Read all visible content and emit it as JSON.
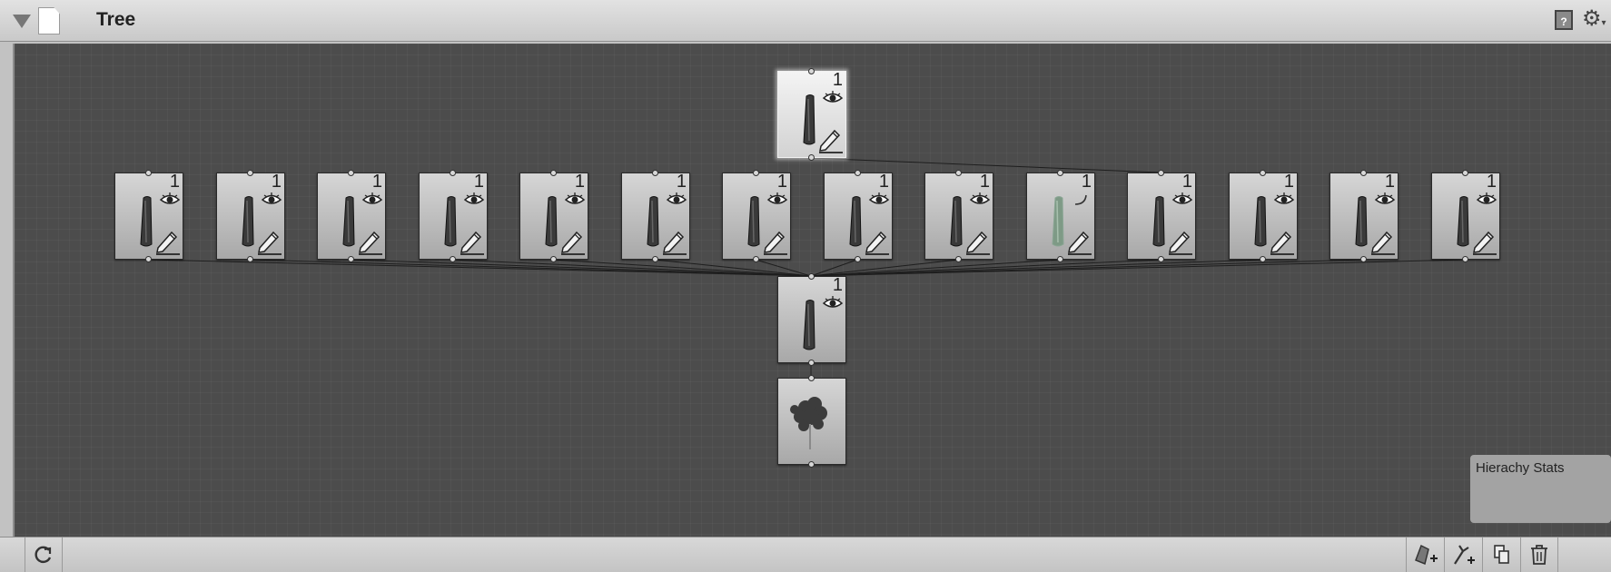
{
  "window": {
    "title": "Tree",
    "icons": [
      "collapse-triangle-icon",
      "document-icon",
      "help-book-icon",
      "gear-icon"
    ]
  },
  "graph": {
    "root": {
      "kind": "branch-group",
      "count": "1",
      "selected": true
    },
    "branch_groups": [
      {
        "count": "1",
        "icon": "eye",
        "dimmed": false
      },
      {
        "count": "1",
        "icon": "eye",
        "dimmed": false
      },
      {
        "count": "1",
        "icon": "eye",
        "dimmed": false
      },
      {
        "count": "1",
        "icon": "eye",
        "dimmed": false
      },
      {
        "count": "1",
        "icon": "eye",
        "dimmed": false
      },
      {
        "count": "1",
        "icon": "eye",
        "dimmed": false
      },
      {
        "count": "1",
        "icon": "eye",
        "dimmed": false
      },
      {
        "count": "1",
        "icon": "eye",
        "dimmed": false
      },
      {
        "count": "1",
        "icon": "eye",
        "dimmed": false
      },
      {
        "count": "1",
        "icon": "hook",
        "dimmed": true
      },
      {
        "count": "1",
        "icon": "eye",
        "dimmed": false
      },
      {
        "count": "1",
        "icon": "eye",
        "dimmed": false
      },
      {
        "count": "1",
        "icon": "eye",
        "dimmed": false
      },
      {
        "count": "1",
        "icon": "eye",
        "dimmed": false
      }
    ],
    "trunk": {
      "count": "1",
      "icon": "eye"
    },
    "tree_root_icon": "tree-icon"
  },
  "stats_panel": {
    "title": "Hierachy Stats"
  },
  "footer": {
    "buttons": [
      "refresh-button",
      "add-leaf-group-button",
      "add-branch-group-button",
      "duplicate-button",
      "delete-button"
    ]
  }
}
